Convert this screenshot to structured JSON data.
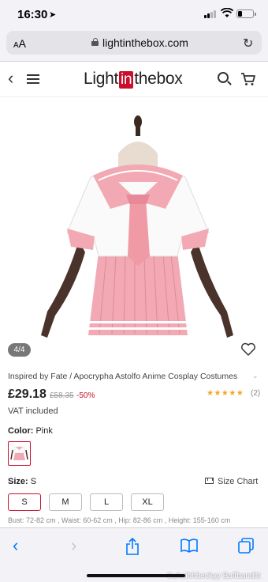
{
  "status_bar": {
    "time": "16:30",
    "battery_level": 0.25
  },
  "browser": {
    "text_size_label": "AA",
    "url": "lightinthebox.com"
  },
  "site_header": {
    "logo_left": "Light",
    "logo_highlight": "in",
    "logo_right": "thebox"
  },
  "product": {
    "photo_counter": "4/4",
    "title": "Inspired by Fate / Apocrypha Astolfo Anime Cosplay Costumes",
    "price": "£29.18",
    "original_price": "£58.35",
    "discount": "-50%",
    "rating_stars": "★★★★★",
    "rating_value": 5,
    "review_count": "(2)",
    "vat_note": "VAT included",
    "color_label": "Color:",
    "color_value": "Pink",
    "size_label": "Size:",
    "size_value": "S",
    "size_chart_label": "Size Chart",
    "sizes": [
      "S",
      "M",
      "L",
      "XL"
    ],
    "selected_size": "S",
    "measurements": "Bust: 72-82 cm , Waist: 60-62 cm , Hip: 82-86 cm , Height: 155-160 cm"
  },
  "watermark": "Suhoihhbeckyy Buffbanditt",
  "colors": {
    "brand_red": "#c8102e",
    "ios_blue": "#007aff",
    "star_gold": "#f5a623"
  }
}
